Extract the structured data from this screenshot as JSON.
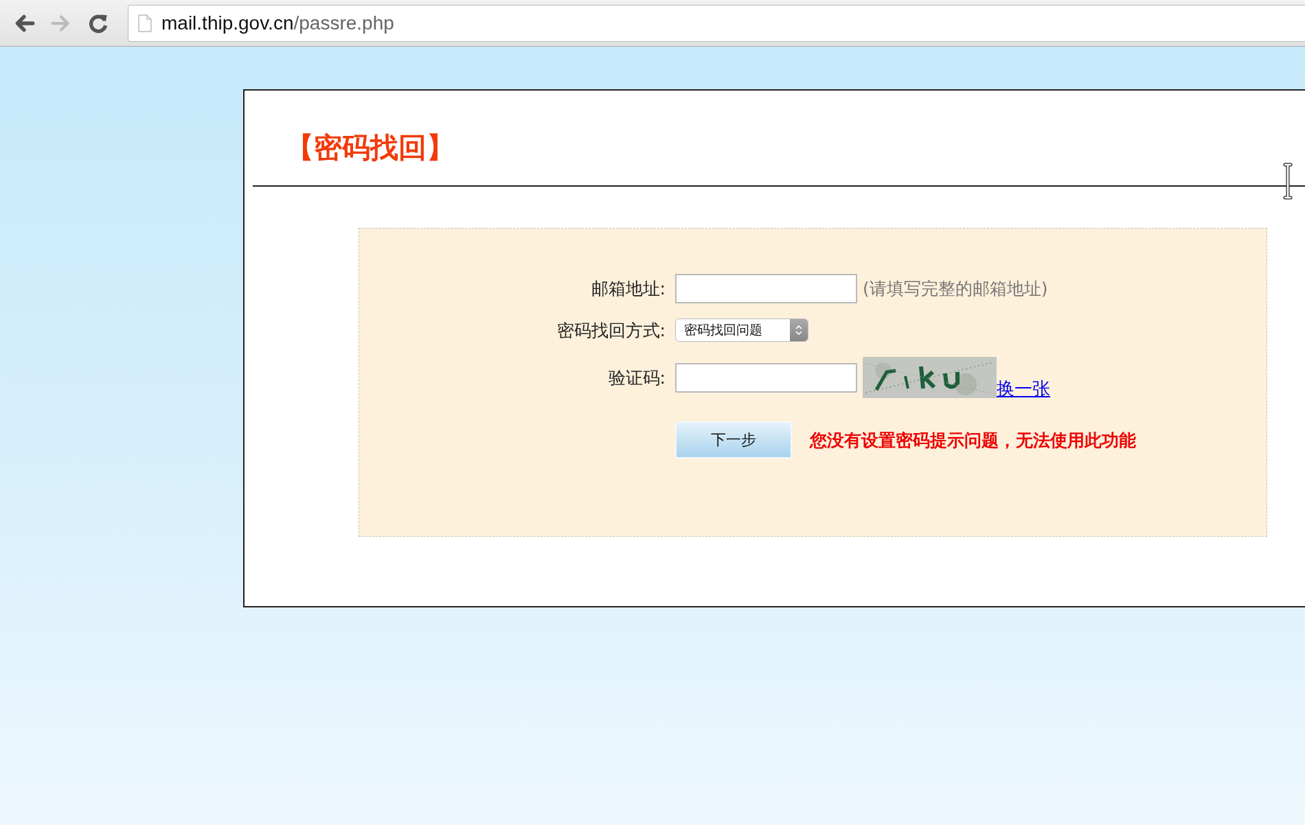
{
  "browser": {
    "address_host": "mail.thip.gov.cn",
    "address_path": "/passre.php",
    "forward_disabled": true
  },
  "page": {
    "title": "【密码找回】",
    "form": {
      "email": {
        "label": "邮箱地址:",
        "hint": "(请填写完整的邮箱地址)"
      },
      "method": {
        "label": "密码找回方式:",
        "value": "密码找回问题"
      },
      "captcha": {
        "label": "验证码:",
        "refresh_link": "换一张"
      },
      "submit": "下一步",
      "error": "您没有设置密码提示问题，无法使用此功能"
    }
  }
}
